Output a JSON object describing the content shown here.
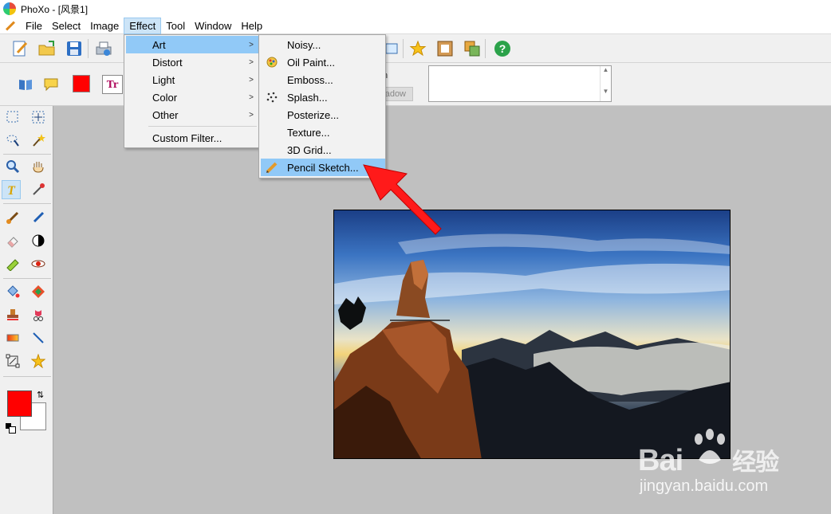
{
  "window": {
    "title": "PhoXo - [风景1]"
  },
  "menubar": {
    "items": [
      "File",
      "Select",
      "Image",
      "Effect",
      "Tool",
      "Window",
      "Help"
    ],
    "active": "Effect"
  },
  "toolbar2": {
    "label_partial": "h",
    "shadow_button": "adow",
    "fg_color": "#ff0000"
  },
  "effect_menu": {
    "items": [
      {
        "label": "Art",
        "has_submenu": true,
        "highlighted": true
      },
      {
        "label": "Distort",
        "has_submenu": true
      },
      {
        "label": "Light",
        "has_submenu": true
      },
      {
        "label": "Color",
        "has_submenu": true
      },
      {
        "label": "Other",
        "has_submenu": true
      },
      {
        "label": "Custom Filter...",
        "has_submenu": false
      }
    ]
  },
  "art_menu": {
    "items": [
      {
        "label": "Noisy...",
        "icon": ""
      },
      {
        "label": "Oil Paint...",
        "icon": "oil-paint-icon"
      },
      {
        "label": "Emboss...",
        "icon": ""
      },
      {
        "label": "Splash...",
        "icon": "splash-icon"
      },
      {
        "label": "Posterize...",
        "icon": ""
      },
      {
        "label": "Texture...",
        "icon": ""
      },
      {
        "label": "3D Grid...",
        "icon": ""
      },
      {
        "label": "Pencil Sketch...",
        "icon": "pencil-icon",
        "highlighted": true
      }
    ]
  },
  "colors": {
    "menu_highlight": "#91c9f7",
    "menu_active": "#cce4f7",
    "foreground": "#ff0000",
    "background": "#ffffff",
    "annotation_arrow": "#ff1a1a"
  },
  "watermark": {
    "brand": "Bai",
    "brand_suffix": "经验",
    "url": "jingyan.baidu.com"
  }
}
